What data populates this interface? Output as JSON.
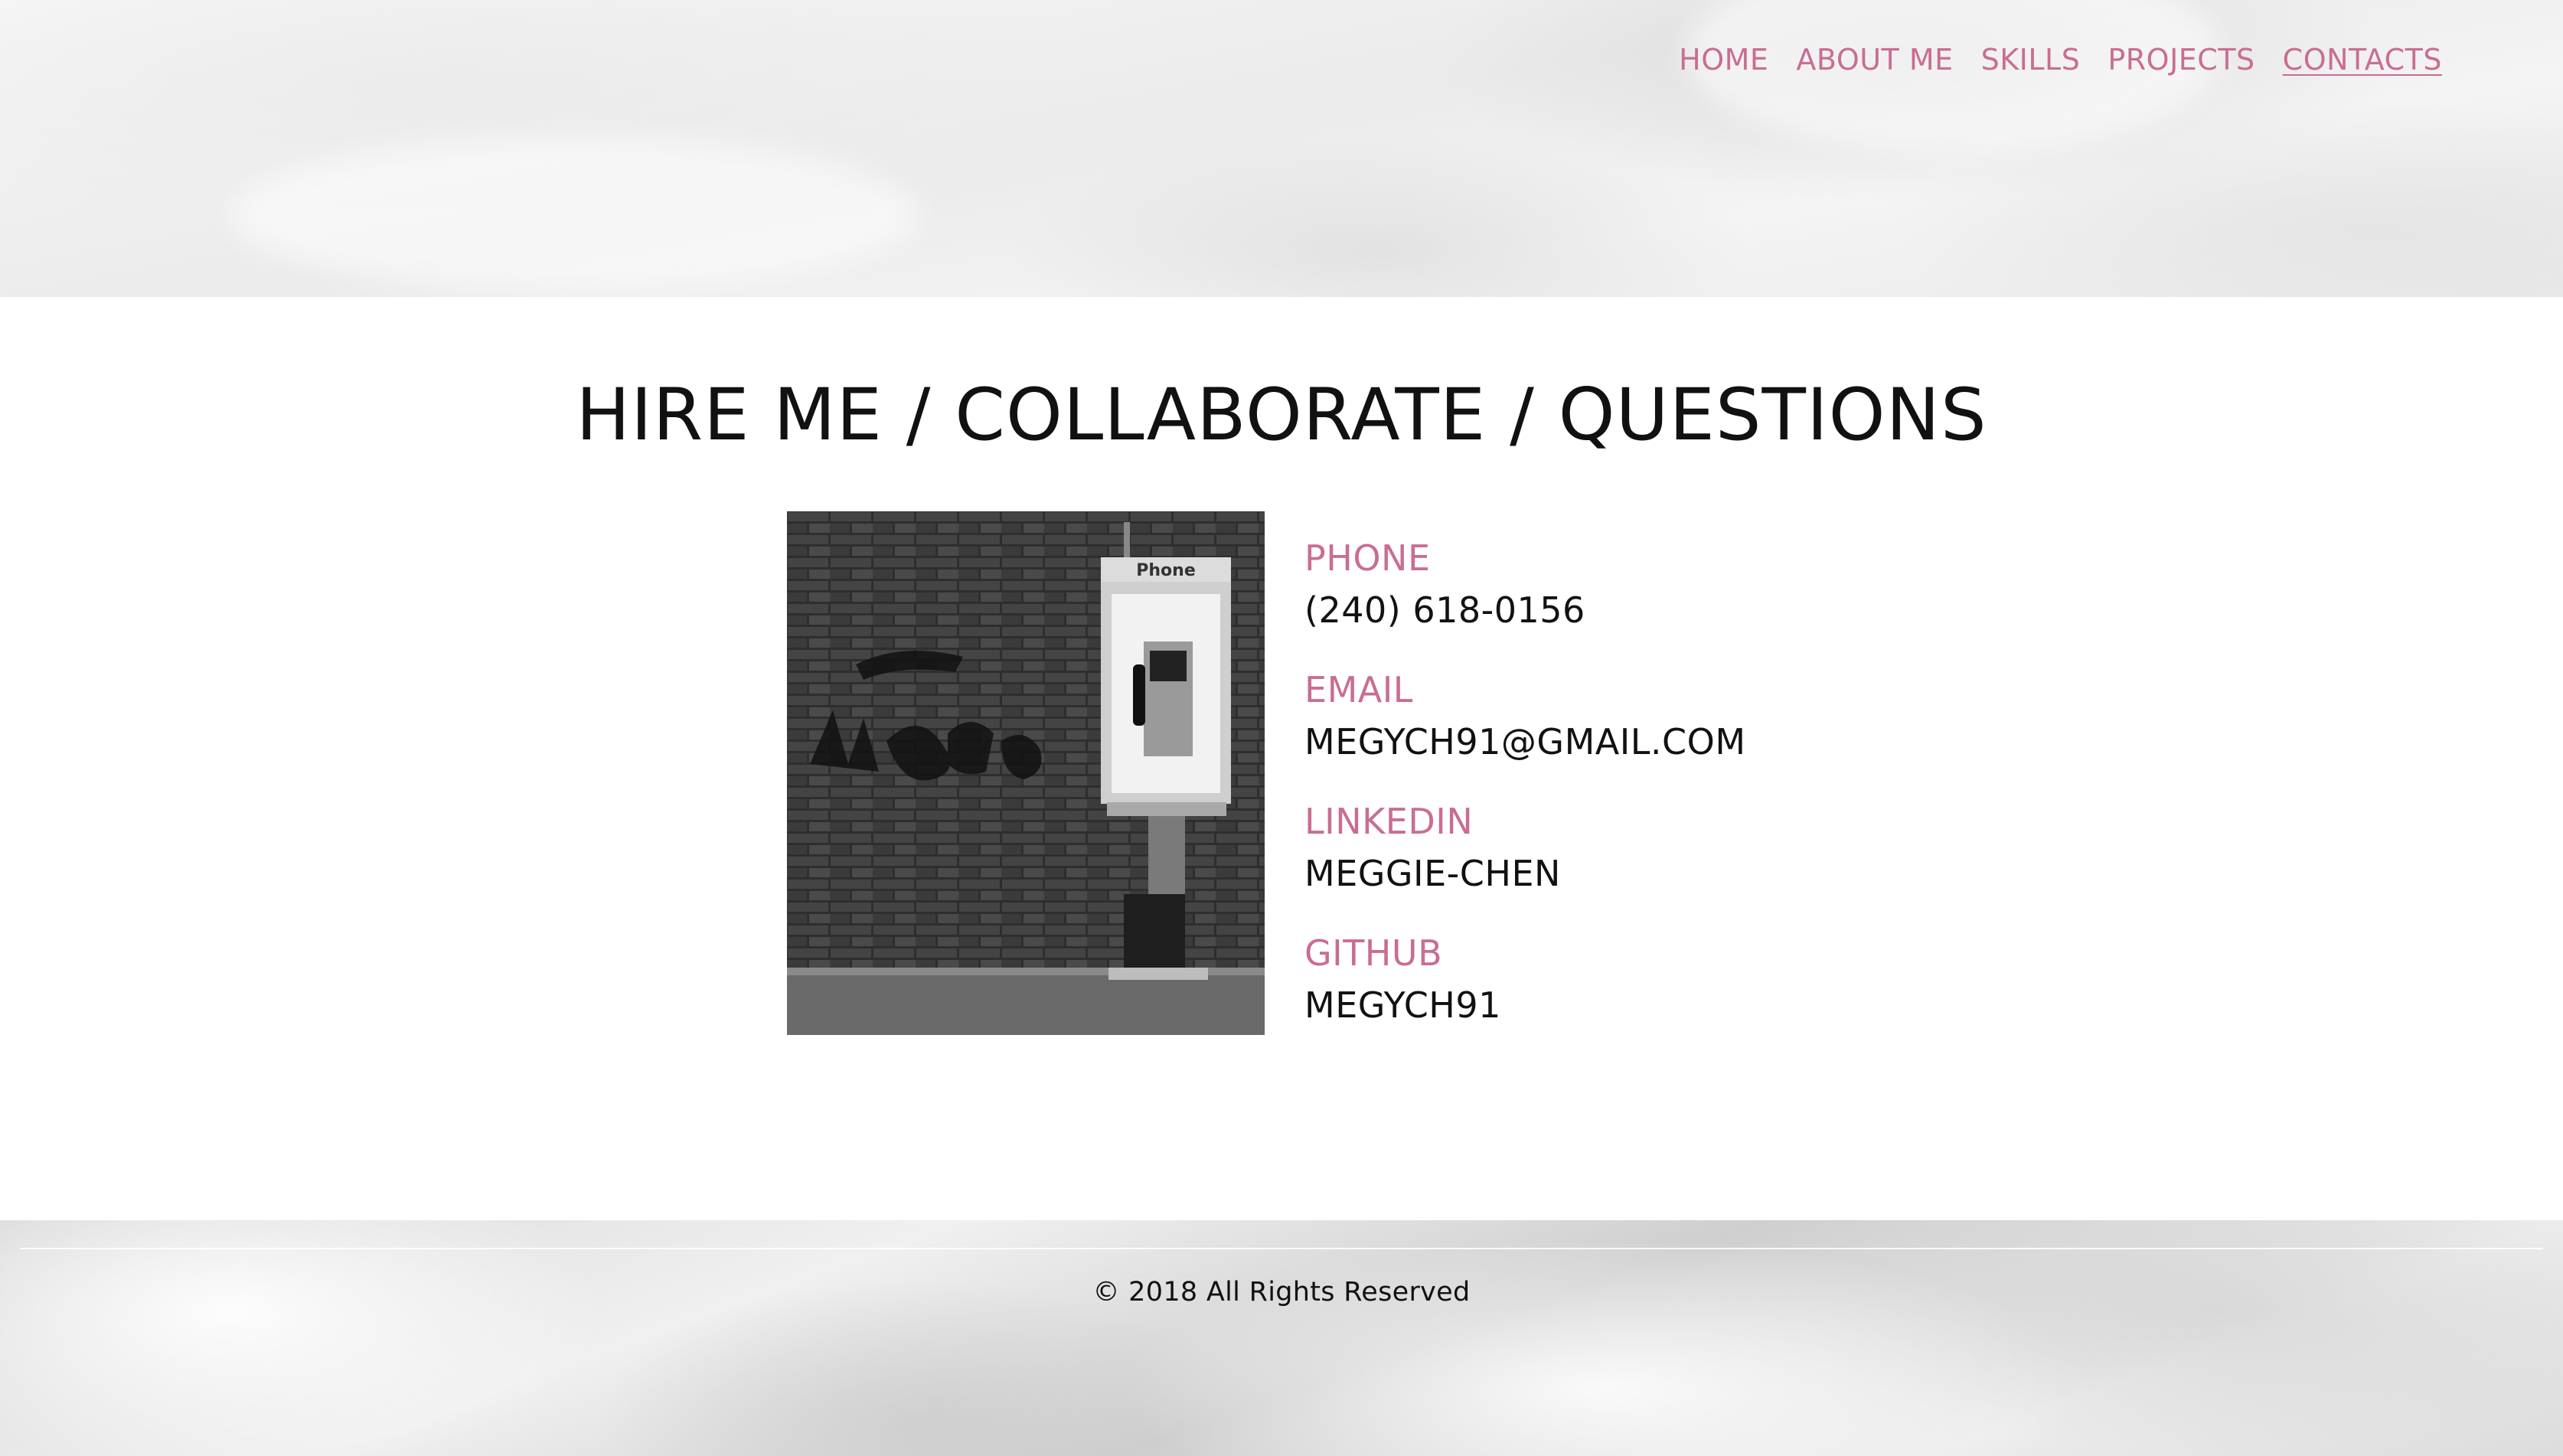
{
  "nav": {
    "items": [
      {
        "label": "HOME"
      },
      {
        "label": "ABOUT ME"
      },
      {
        "label": "SKILLS"
      },
      {
        "label": "PROJECTS"
      },
      {
        "label": "CONTACTS"
      }
    ],
    "active": "CONTACTS",
    "accent_color": "#c96d93"
  },
  "main": {
    "title": "HIRE ME / COLLABORATE / QUESTIONS",
    "photo": {
      "subject": "payphone-on-brick-wall",
      "sign_text": "Phone"
    },
    "contacts": [
      {
        "label": "PHONE",
        "value": "(240) 618-0156"
      },
      {
        "label": "EMAIL",
        "value": "MEGYCH91@GMAIL.COM"
      },
      {
        "label": "LINKEDIN",
        "value": "MEGGIE-CHEN"
      },
      {
        "label": "GITHUB",
        "value": "MEGYCH91"
      }
    ]
  },
  "footer": {
    "copyright": "© 2018 All Rights Reserved"
  }
}
